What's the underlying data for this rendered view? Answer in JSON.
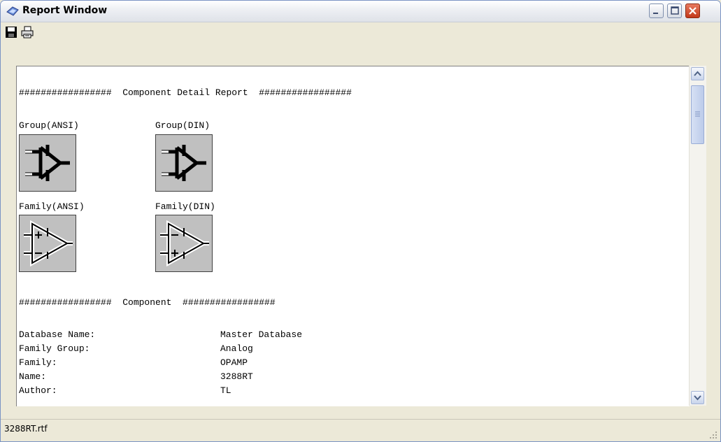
{
  "window": {
    "title": "Report Window",
    "buttons": {
      "minimize": "minimize",
      "maximize": "maximize",
      "close": "close"
    }
  },
  "toolbar": {
    "save_icon": "save-icon",
    "print_icon": "print-icon"
  },
  "report": {
    "header_line": "#################  Component Detail Report  #################",
    "symbols": [
      {
        "label": "Group(ANSI)"
      },
      {
        "label": "Group(DIN)"
      },
      {
        "label": "Family(ANSI)"
      },
      {
        "label": "Family(DIN)"
      }
    ],
    "component_header": "#################  Component  #################",
    "fields": [
      {
        "key": "Database Name:",
        "value": "Master Database"
      },
      {
        "key": "Family Group:",
        "value": "Analog"
      },
      {
        "key": "Family:",
        "value": "OPAMP"
      },
      {
        "key": "Name:",
        "value": "3288RT"
      },
      {
        "key": "Author:",
        "value": "TL"
      }
    ]
  },
  "statusbar": {
    "text": "3288RT.rtf"
  }
}
